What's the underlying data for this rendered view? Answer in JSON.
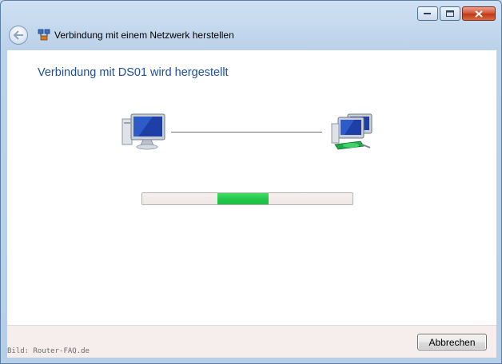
{
  "window": {
    "title": "Verbindung mit einem Netzwerk herstellen",
    "controls": [
      "minimize-icon",
      "maximize-icon",
      "close-icon"
    ]
  },
  "main": {
    "heading": "Verbindung mit DS01 wird hergestellt",
    "progress_fraction": 0.24
  },
  "footer": {
    "cancel_label": "Abbrechen"
  },
  "watermark": "Bild: Router-FAQ.de",
  "colors": {
    "heading": "#1e4e9c",
    "progress_fill": "#22c648",
    "close_button": "#c2381a"
  }
}
